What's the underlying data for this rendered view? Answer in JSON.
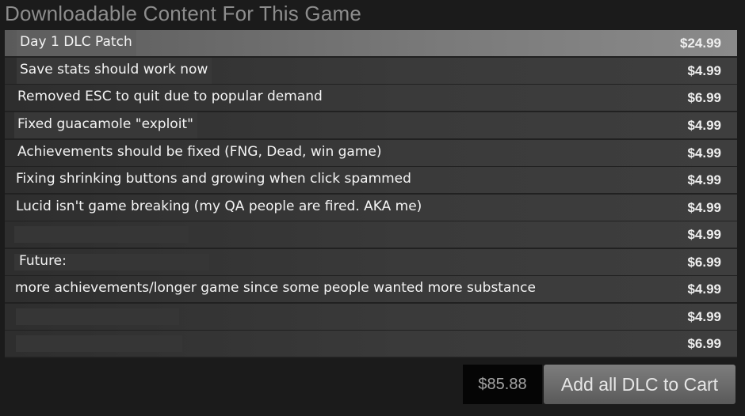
{
  "section": {
    "title": "Downloadable Content For This Game"
  },
  "dlc_items": [
    {
      "name": "Day 1 DLC Patch",
      "price": "$24.99"
    },
    {
      "name": "Save stats should work now",
      "price": "$4.99"
    },
    {
      "name": "Removed ESC to quit due to popular demand",
      "price": "$6.99"
    },
    {
      "name": "Fixed guacamole \"exploit\"",
      "price": "$4.99"
    },
    {
      "name": "Achievements should be fixed (FNG, Dead, win game)",
      "price": "$4.99"
    },
    {
      "name": "Fixing shrinking buttons and growing when click spammed",
      "price": "$4.99"
    },
    {
      "name": "Lucid isn't game breaking (my QA people are fired. AKA me)",
      "price": "$4.99"
    },
    {
      "name": "",
      "price": "$4.99"
    },
    {
      "name": "Future:",
      "price": "$6.99"
    },
    {
      "name": "more achievements/longer game since some people wanted more substance",
      "price": "$4.99"
    },
    {
      "name": "",
      "price": "$4.99"
    },
    {
      "name": "",
      "price": "$6.99"
    }
  ],
  "purchase": {
    "total": "$85.88",
    "add_all_label": "Add all DLC to Cart"
  },
  "colors": {
    "page_background": "#1b1b1b",
    "row_background": "#3a3a3a",
    "row_highlight": "#7a7a7a",
    "title_text": "#8d8d8d",
    "item_text": "#f4f4f4",
    "button_background": "#6c6c6c"
  }
}
